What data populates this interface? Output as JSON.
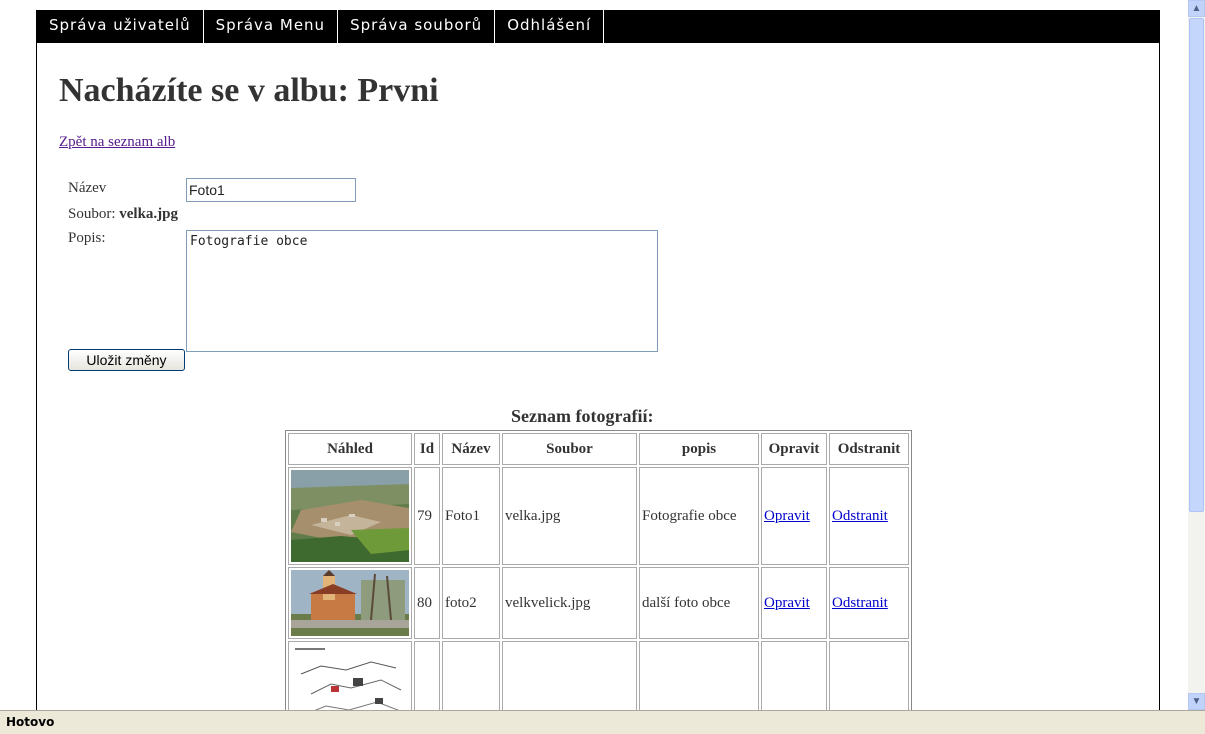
{
  "nav": {
    "items": [
      "Správa uživatelů",
      "Správa Menu",
      "Správa souborů",
      "Odhlášení"
    ]
  },
  "page": {
    "title": "Nacházíte se v albu: Prvni",
    "back_link": "Zpět na seznam alb"
  },
  "form": {
    "name_label": "Název",
    "name_value": "Foto1",
    "file_label": "Soubor:",
    "file_value": "velka.jpg",
    "desc_label": "Popis:",
    "desc_value": "Fotografie obce",
    "save_label": "Uložit změny"
  },
  "photos": {
    "title": "Seznam fotografií:",
    "headers": [
      "Náhled",
      "Id",
      "Název",
      "Soubor",
      "popis",
      "Opravit",
      "Odstranit"
    ],
    "rows": [
      {
        "id": "79",
        "name": "Foto1",
        "file": "velka.jpg",
        "desc": "Fotografie obce",
        "edit": "Opravit",
        "remove": "Odstranit"
      },
      {
        "id": "80",
        "name": "foto2",
        "file": "velkvelick.jpg",
        "desc": "další foto obce",
        "edit": "Opravit",
        "remove": "Odstranit"
      },
      {
        "id": "",
        "name": "",
        "file": "",
        "desc": "",
        "edit": "",
        "remove": ""
      }
    ]
  },
  "status_bar": {
    "text": "Hotovo"
  }
}
